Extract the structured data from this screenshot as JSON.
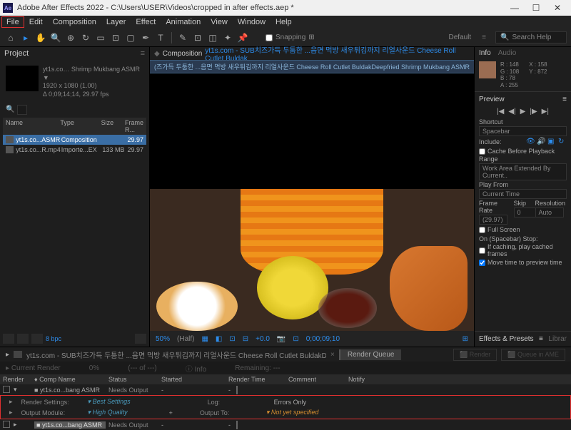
{
  "titlebar": {
    "app_icon": "Ae",
    "title": "Adobe After Effects 2022 - C:\\Users\\USER\\Videos\\cropped in after effects.aep *"
  },
  "menu": {
    "file": "File",
    "edit": "Edit",
    "composition": "Composition",
    "layer": "Layer",
    "effect": "Effect",
    "animation": "Animation",
    "view": "View",
    "window": "Window",
    "help": "Help"
  },
  "toolbar": {
    "snapping": "Snapping",
    "default": "Default",
    "search_ph": "Search Help"
  },
  "project": {
    "tab": "Project",
    "thumb_name": "yt1s.co… Shrimp Mukbang ASMR ▼",
    "thumb_res": "1920 x 1080 (1.00)",
    "thumb_dur": "Δ 0;09;14;14, 29.97 fps",
    "cols": {
      "name": "Name",
      "type": "Type",
      "size": "Size",
      "frame": "Frame R..."
    },
    "rows": [
      {
        "name": "yt1s.co...ASMR",
        "type": "Composition",
        "size": "",
        "fr": "29.97"
      },
      {
        "name": "yt1s.co...R.mp4",
        "type": "Importe...EX",
        "size": "133 MB",
        "fr": "29.97"
      }
    ]
  },
  "comp": {
    "label": "Composition",
    "name": "yt1s.com - SUB치즈가득 두툼한 ...음면 먹방 새우튀김까지 리얼사운드 Cheese Roll Cutlet Buldak",
    "breadcrumb": "(즈가득 두툼한 ...음면 먹방 새우튀김까지 리얼사운드 Cheese Roll Cutlet BuldakDeepfried Shrimp Mukbang ASMR",
    "zoom": "50%",
    "res": "(Half)",
    "exp": "+0.0",
    "time": "0;00;09;10"
  },
  "info": {
    "tab1": "Info",
    "tab2": "Audio",
    "r": "R : 148",
    "g": "G : 108",
    "b": "B : 78",
    "a": "A : 255",
    "x": "X : 158",
    "y": "Y : 872",
    "preview": "Preview",
    "shortcut_l": "Shortcut",
    "shortcut_v": "Spacebar",
    "include": "Include:",
    "cache": "Cache Before Playback",
    "range_l": "Range",
    "range_v": "Work Area Extended By Current..",
    "playfrom_l": "Play From",
    "playfrom_v": "Current Time",
    "fr_l": "Frame Rate",
    "skip_l": "Skip",
    "res_l": "Resolution",
    "fr_v": "(29.97)",
    "skip_v": "0",
    "res_v": "Auto",
    "fullscreen": "Full Screen",
    "onstop": "On (Spacebar) Stop:",
    "cache2": "If caching, play cached frames",
    "move": "Move time to preview time",
    "effects": "Effects & Presets",
    "libs": "Librar"
  },
  "rq": {
    "tab": "yt1s.com - SUB치즈가득 두툼한 ...음면 먹방 새우튀김까지 리얼사운드 Cheese Roll Cutlet BuldakDeepfried Shrimp Mukbang ASMR",
    "btn": "Render Queue",
    "queue_ame": "Queue in AME",
    "render": "Render",
    "cur": "Current Render",
    "pct": "0%",
    "of": "(--- of ---)",
    "info_b": "Info",
    "remaining": "Remaining:",
    "dash": "---",
    "h": {
      "render": "Render",
      "comp": "Comp Name",
      "status": "Status",
      "started": "Started",
      "rtime": "Render Time",
      "comment": "Comment",
      "notify": "Notify"
    },
    "row": {
      "comp": "yt1s.co...bang ASMR",
      "status": "Needs Output",
      "dash": "-"
    },
    "rs_l": "Render Settings:",
    "rs_v": "Best Settings",
    "log_l": "Log:",
    "log_v": "Errors Only",
    "om_l": "Output Module:",
    "om_v": "High Quality",
    "out_l": "Output To:",
    "out_v": "Not yet specified",
    "row2": {
      "comp": "yt1s.co...bang ASMR",
      "status": "Needs Output"
    }
  },
  "tl": {
    "bpc": "8 bpc"
  }
}
